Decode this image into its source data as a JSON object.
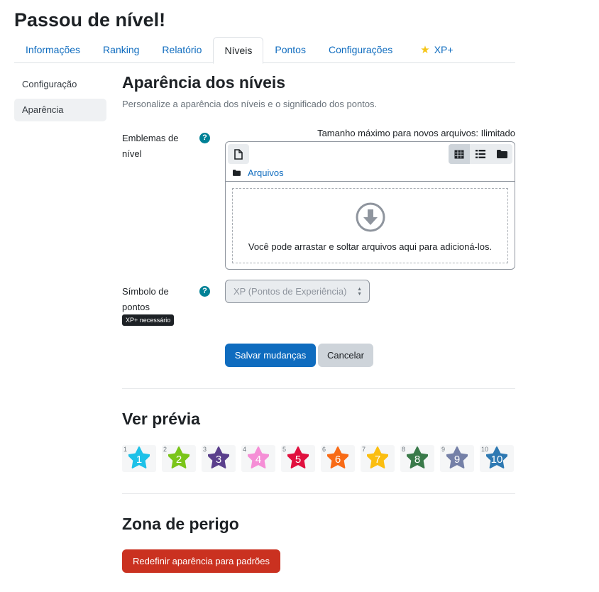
{
  "page": {
    "title": "Passou de nível!"
  },
  "tabs": [
    {
      "label": "Informações"
    },
    {
      "label": "Ranking"
    },
    {
      "label": "Relatório"
    },
    {
      "label": "Níveis",
      "active": true
    },
    {
      "label": "Pontos"
    },
    {
      "label": "Configurações"
    },
    {
      "label": "XP+",
      "icon": "star-icon"
    }
  ],
  "sidenav": {
    "items": [
      {
        "label": "Configuração"
      },
      {
        "label": "Aparência",
        "active": true
      }
    ]
  },
  "main": {
    "heading": "Aparência dos níveis",
    "subtitle": "Personalize a aparência dos níveis e o significado dos pontos.",
    "badges_field": {
      "label": "Emblemas de nível",
      "max_size": "Tamanho máximo para novos arquivos: Ilimitado",
      "path_label": "Arquivos",
      "dropzone_text": "Você pode arrastar e soltar arquivos aqui para adicioná-los."
    },
    "points_field": {
      "label": "Símbolo de pontos",
      "select_value": "XP (Pontos de Experiência)",
      "badge": "XP+ necessário"
    },
    "save_label": "Salvar mudanças",
    "cancel_label": "Cancelar"
  },
  "preview": {
    "heading": "Ver prévia",
    "levels": [
      {
        "level": "1",
        "color": "#1ec1e8"
      },
      {
        "level": "2",
        "color": "#7ac519"
      },
      {
        "level": "3",
        "color": "#5a3f8c"
      },
      {
        "level": "4",
        "color": "#f58ed6"
      },
      {
        "level": "5",
        "color": "#e0103e"
      },
      {
        "level": "6",
        "color": "#f86b16"
      },
      {
        "level": "7",
        "color": "#fbbe11"
      },
      {
        "level": "8",
        "color": "#3a7a4a"
      },
      {
        "level": "9",
        "color": "#7580a7"
      },
      {
        "level": "10",
        "color": "#2e79b2"
      }
    ]
  },
  "danger": {
    "heading": "Zona de perigo",
    "reset_label": "Redefinir aparência para padrões"
  },
  "colors": {
    "primary": "#0f6cbf",
    "danger": "#ca3120",
    "help": "#008196"
  }
}
